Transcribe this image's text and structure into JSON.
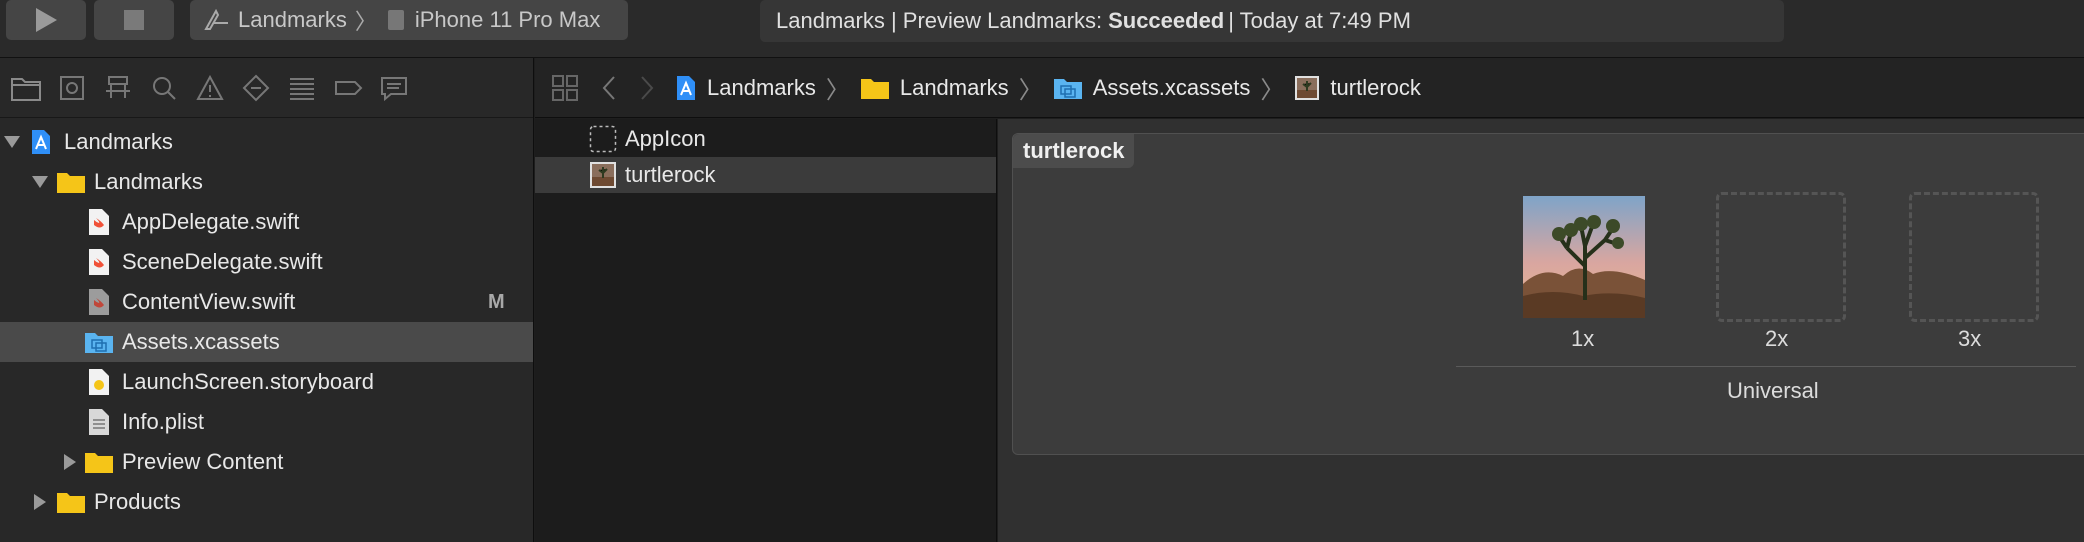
{
  "toolbar": {
    "run_icon": "play-icon",
    "stop_icon": "stop-icon",
    "scheme": {
      "target": "Landmarks",
      "device": "iPhone 11 Pro Max"
    },
    "status": {
      "prefix": "Landmarks | Preview Landmarks:",
      "result": "Succeeded",
      "suffix": "| Today at 7:49 PM"
    }
  },
  "navigator": {
    "tabs": [
      "folder-icon",
      "source-control-icon",
      "hierarchy-icon",
      "search-icon",
      "warning-icon",
      "test-icon",
      "debug-icon",
      "breakpoint-icon",
      "report-icon"
    ],
    "items": [
      {
        "label": "Landmarks",
        "icon": "xcode-project-icon",
        "disclosure": "down",
        "level": 0
      },
      {
        "label": "Landmarks",
        "icon": "folder-icon",
        "disclosure": "down",
        "level": 1
      },
      {
        "label": "AppDelegate.swift",
        "icon": "swift-file-icon",
        "level": 2
      },
      {
        "label": "SceneDelegate.swift",
        "icon": "swift-file-icon",
        "level": 2
      },
      {
        "label": "ContentView.swift",
        "icon": "swift-file-icon",
        "level": 2,
        "badge": "M"
      },
      {
        "label": "Assets.xcassets",
        "icon": "asset-catalog-icon",
        "level": 2,
        "selected": true
      },
      {
        "label": "LaunchScreen.storyboard",
        "icon": "storyboard-icon",
        "level": 2
      },
      {
        "label": "Info.plist",
        "icon": "plist-icon",
        "level": 2
      },
      {
        "label": "Preview Content",
        "icon": "folder-icon",
        "disclosure": "right",
        "level": 2
      },
      {
        "label": "Products",
        "icon": "folder-icon",
        "disclosure": "right",
        "level": 1
      }
    ]
  },
  "jumpbar": {
    "crumbs": [
      "Landmarks",
      "Landmarks",
      "Assets.xcassets",
      "turtlerock"
    ]
  },
  "assets": {
    "items": [
      {
        "label": "AppIcon",
        "icon": "appicon-placeholder-icon"
      },
      {
        "label": "turtlerock",
        "icon": "image-thumbnail-icon",
        "selected": true
      }
    ]
  },
  "imageset": {
    "title": "turtlerock",
    "slots": [
      "1x",
      "2x",
      "3x"
    ],
    "group_label": "Universal"
  },
  "colors": {
    "selection": "#4a4a4a",
    "folder": "#f5c518",
    "swift": "#f05138",
    "xcode_blue": "#2f8ff7"
  }
}
